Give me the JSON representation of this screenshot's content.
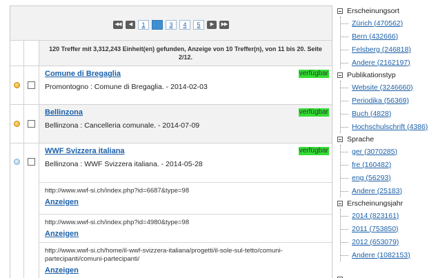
{
  "pager": {
    "first_icon": "double-left-icon",
    "prev_icon": "left-icon",
    "pages": [
      "1",
      "2",
      "3",
      "4",
      "5"
    ],
    "active_page": "2",
    "next_icon": "right-icon",
    "last_icon": "double-right-icon"
  },
  "summary": "120 Treffer mit 3,312,243 Einheit(en) gefunden, Anzeige von 10 Treffer(n), von 11 bis 20. Seite 2/12.",
  "hits": [
    {
      "title": "Comune di Bregaglia",
      "availability": "verfügbar",
      "description": "Promontogno : Comune di Bregaglia. - 2014-02-03",
      "bullet": "orange",
      "shaded": false
    },
    {
      "title": "Bellinzona",
      "availability": "verfügbar",
      "description": "Bellinzona : Cancelleria comunale. - 2014-07-09",
      "bullet": "orange",
      "shaded": true
    },
    {
      "title": "WWF Svizzera italiana",
      "availability": "verfügbar",
      "description": "Bellinzona : WWF Svizzera italiana. - 2014-05-28",
      "bullet": "blue",
      "shaded": false
    }
  ],
  "links": [
    {
      "url": "http://www.wwf-si.ch/index.php?id=6687&type=98",
      "action": "Anzeigen"
    },
    {
      "url": "http://www.wwf-si.ch/index.php?id=4980&type=98",
      "action": "Anzeigen"
    },
    {
      "url": "http://www.wwf-si.ch/home/il-wwf-svizzera-italiana/progetti/il-sole-sul-tetto/comuni-partecipanti/comuni-partecipanti/",
      "action": "Anzeigen"
    }
  ],
  "facets": [
    {
      "label": "Erscheinungsort",
      "items": [
        "Zürich (470562)",
        "Bern (432666)",
        "Felsberg (246818)",
        "Andere (2162197)"
      ]
    },
    {
      "label": "Publikationstyp",
      "items": [
        "Website (3246660)",
        "Periodika (56369)",
        "Buch (4828)",
        "Hochschulschrift (4386)"
      ]
    },
    {
      "label": "Sprache",
      "items": [
        "ger (3070285)",
        "fre (160482)",
        "eng (56293)",
        "Andere (25183)"
      ]
    },
    {
      "label": "Erscheinungsjahr",
      "items": [
        "2014 (823161)",
        "2011 (753850)",
        "2012 (653079)",
        "Andere (1082153)"
      ]
    }
  ],
  "colors": {
    "link": "#1a5fa8",
    "available_badge": "#33dd33",
    "active_page": "#3f8fd1"
  }
}
